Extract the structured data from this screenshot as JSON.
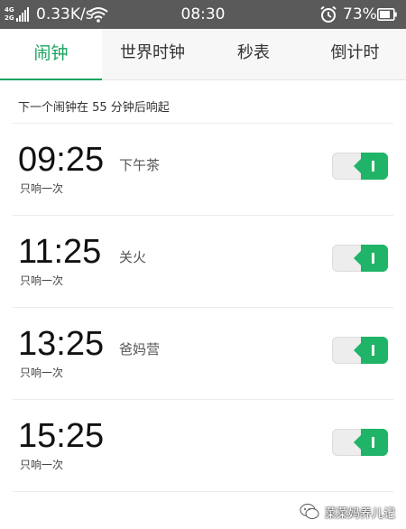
{
  "status_bar": {
    "network_gen_top": "4G",
    "network_gen_bottom": "2G",
    "speed": "0.33K/s",
    "time": "08:30",
    "battery_percent": "73%",
    "icons": [
      "signal-icon",
      "wifi-icon",
      "alarm-clock-icon",
      "battery-icon"
    ]
  },
  "tabs": [
    {
      "label": "闹钟",
      "active": true
    },
    {
      "label": "世界时钟",
      "active": false
    },
    {
      "label": "秒表",
      "active": false
    },
    {
      "label": "倒计时",
      "active": false
    }
  ],
  "next_alarm_text": "下一个闹钟在 55 分钟后响起",
  "alarms": [
    {
      "time": "09:25",
      "label": "下午茶",
      "repeat": "只响一次",
      "enabled": true
    },
    {
      "time": "11:25",
      "label": "关火",
      "repeat": "只响一次",
      "enabled": true
    },
    {
      "time": "13:25",
      "label": "爸妈营",
      "repeat": "只响一次",
      "enabled": true
    },
    {
      "time": "15:25",
      "label": "",
      "repeat": "只响一次",
      "enabled": true
    }
  ],
  "watermark": "菜菜妈养儿记",
  "colors": {
    "accent": "#1aa35f",
    "toggle_on": "#1fb467",
    "status_bar": "#5a5a5a"
  }
}
